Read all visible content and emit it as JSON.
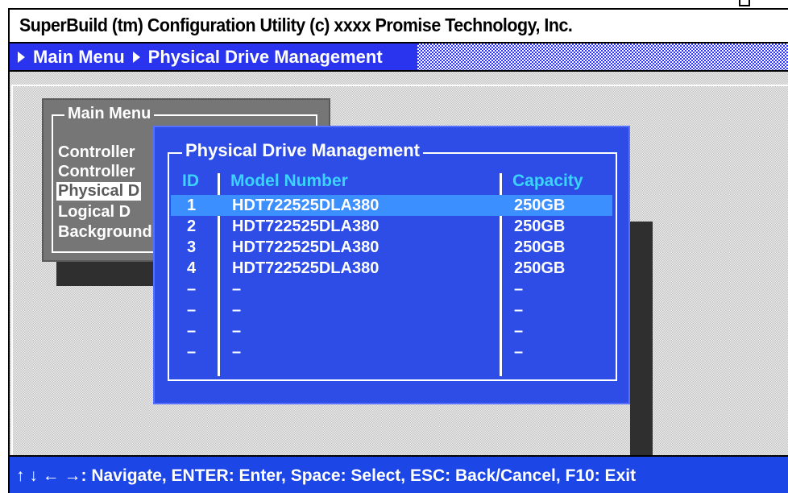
{
  "title_bar": {
    "text": "SuperBuild (tm) Configuration Utility (c) xxxx Promise Technology, Inc."
  },
  "breadcrumb": {
    "items": [
      "Main Menu",
      "Physical Drive Management"
    ]
  },
  "main_menu": {
    "title": "Main Menu",
    "items": [
      {
        "label": "Controller"
      },
      {
        "label": "Controller"
      },
      {
        "label": "Physical D"
      },
      {
        "label": "Logical D"
      },
      {
        "label": "Background"
      }
    ],
    "selected_index": 2
  },
  "dialog": {
    "title": "Physical Drive Management",
    "columns": {
      "id": "ID",
      "model": "Model Number",
      "capacity": "Capacity"
    },
    "rows": [
      {
        "id": "1",
        "model": "HDT722525DLA380",
        "capacity": "250GB"
      },
      {
        "id": "2",
        "model": "HDT722525DLA380",
        "capacity": "250GB"
      },
      {
        "id": "3",
        "model": "HDT722525DLA380",
        "capacity": "250GB"
      },
      {
        "id": "4",
        "model": "HDT722525DLA380",
        "capacity": "250GB"
      },
      {
        "id": "–",
        "model": "–",
        "capacity": "–"
      },
      {
        "id": "–",
        "model": "–",
        "capacity": "–"
      },
      {
        "id": "–",
        "model": "–",
        "capacity": "–"
      },
      {
        "id": "–",
        "model": "–",
        "capacity": "–"
      }
    ],
    "selected_index": 0
  },
  "status_bar": {
    "text": "↑ ↓ ← →: Navigate, ENTER: Enter, Space: Select, ESC: Back/Cancel, F10: Exit"
  },
  "colors": {
    "dialog_bg": "#2d4de6",
    "selection": "#3c8fff",
    "header_text": "#3ad4ff",
    "status_bg": "#1c46e6"
  }
}
